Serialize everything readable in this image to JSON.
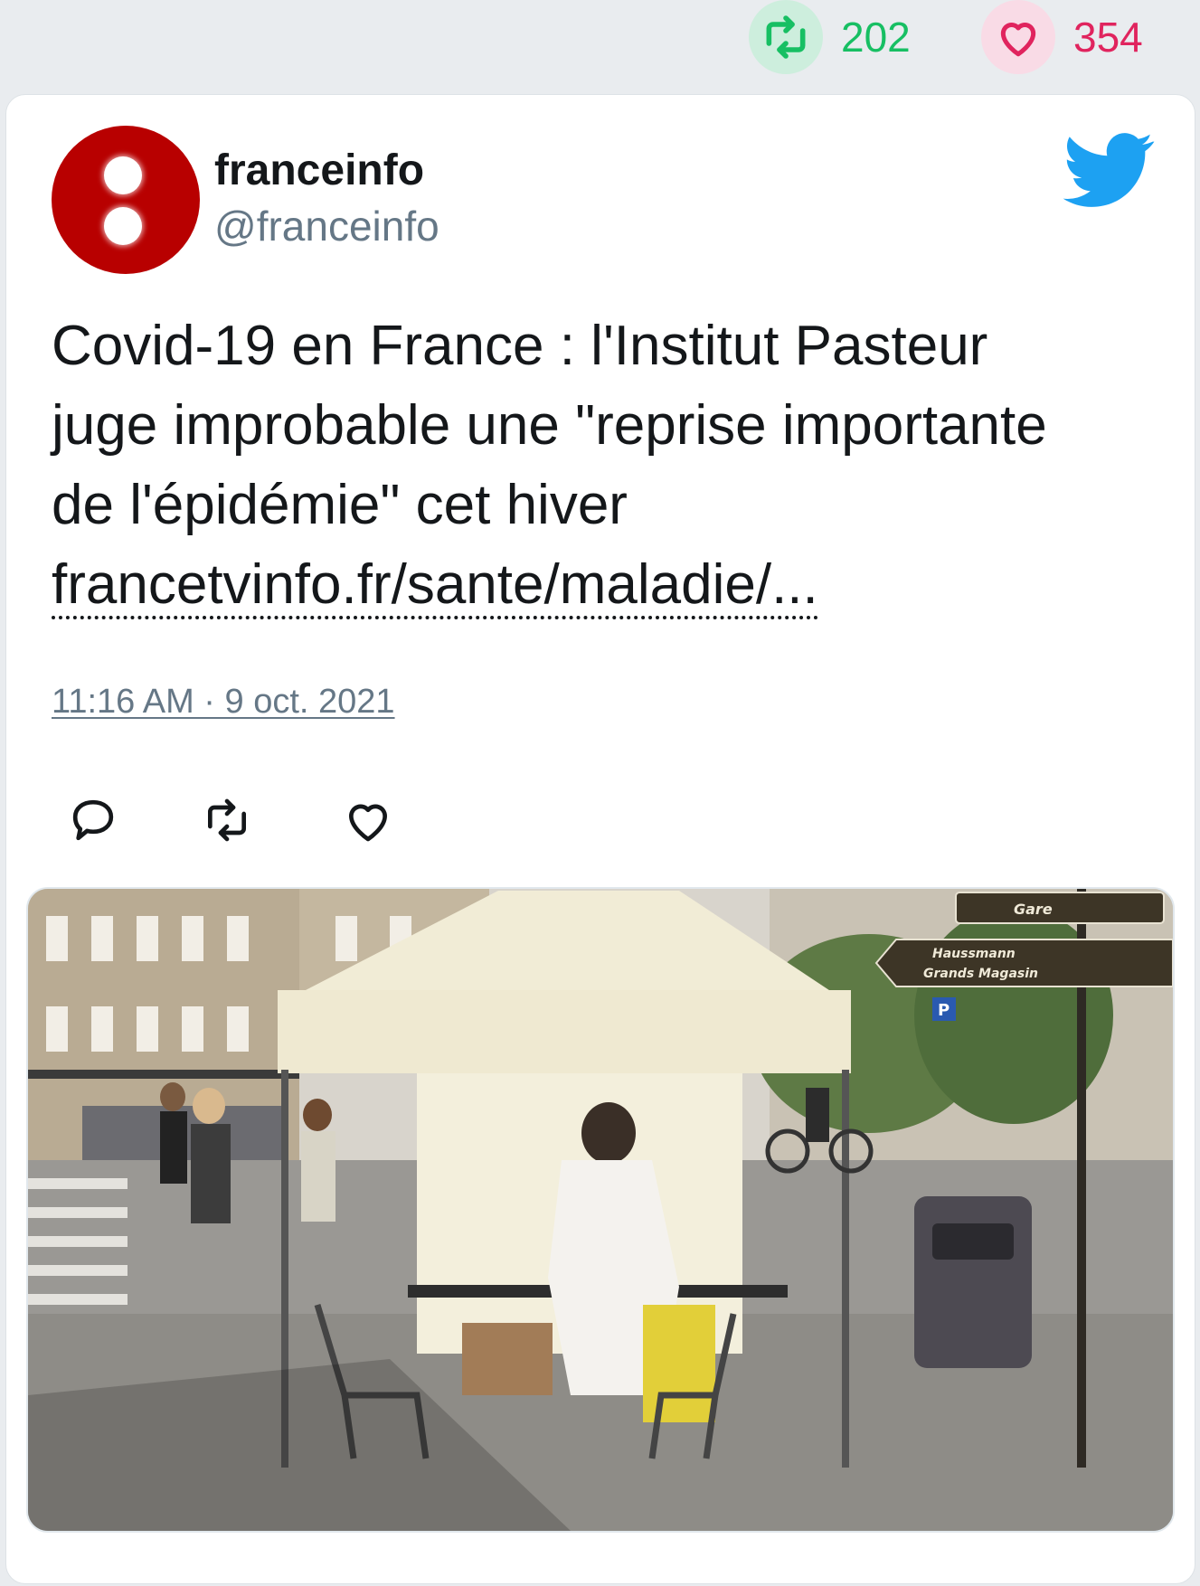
{
  "top_stats": {
    "retweet_icon": "retweet-icon",
    "retweets": "202",
    "like_icon": "heart-icon",
    "likes": "354"
  },
  "tweet": {
    "author_name": "franceinfo",
    "author_handle": "@franceinfo",
    "text_lines": [
      "Covid-19 en France : l'Institut Pasteur",
      "juge improbable une \"reprise importante",
      "de l'épidémie\" cet hiver"
    ],
    "link_text": "francetvinfo.fr/sante/maladie/...",
    "timestamp": "11:16 AM · 9 oct. 2021",
    "platform_icon": "twitter-bird-icon",
    "actions": [
      "reply-icon",
      "retweet-icon",
      "like-icon"
    ]
  },
  "photo": {
    "signs": {
      "gare": "Gare",
      "haussmann": "Haussmann",
      "grands_magasins": "Grands Magasin",
      "parking": "P"
    }
  },
  "colors": {
    "retweet_green": "#17bf63",
    "like_pink": "#e0245e",
    "twitter_blue": "#1da1f2",
    "avatar_red": "#b80000"
  }
}
